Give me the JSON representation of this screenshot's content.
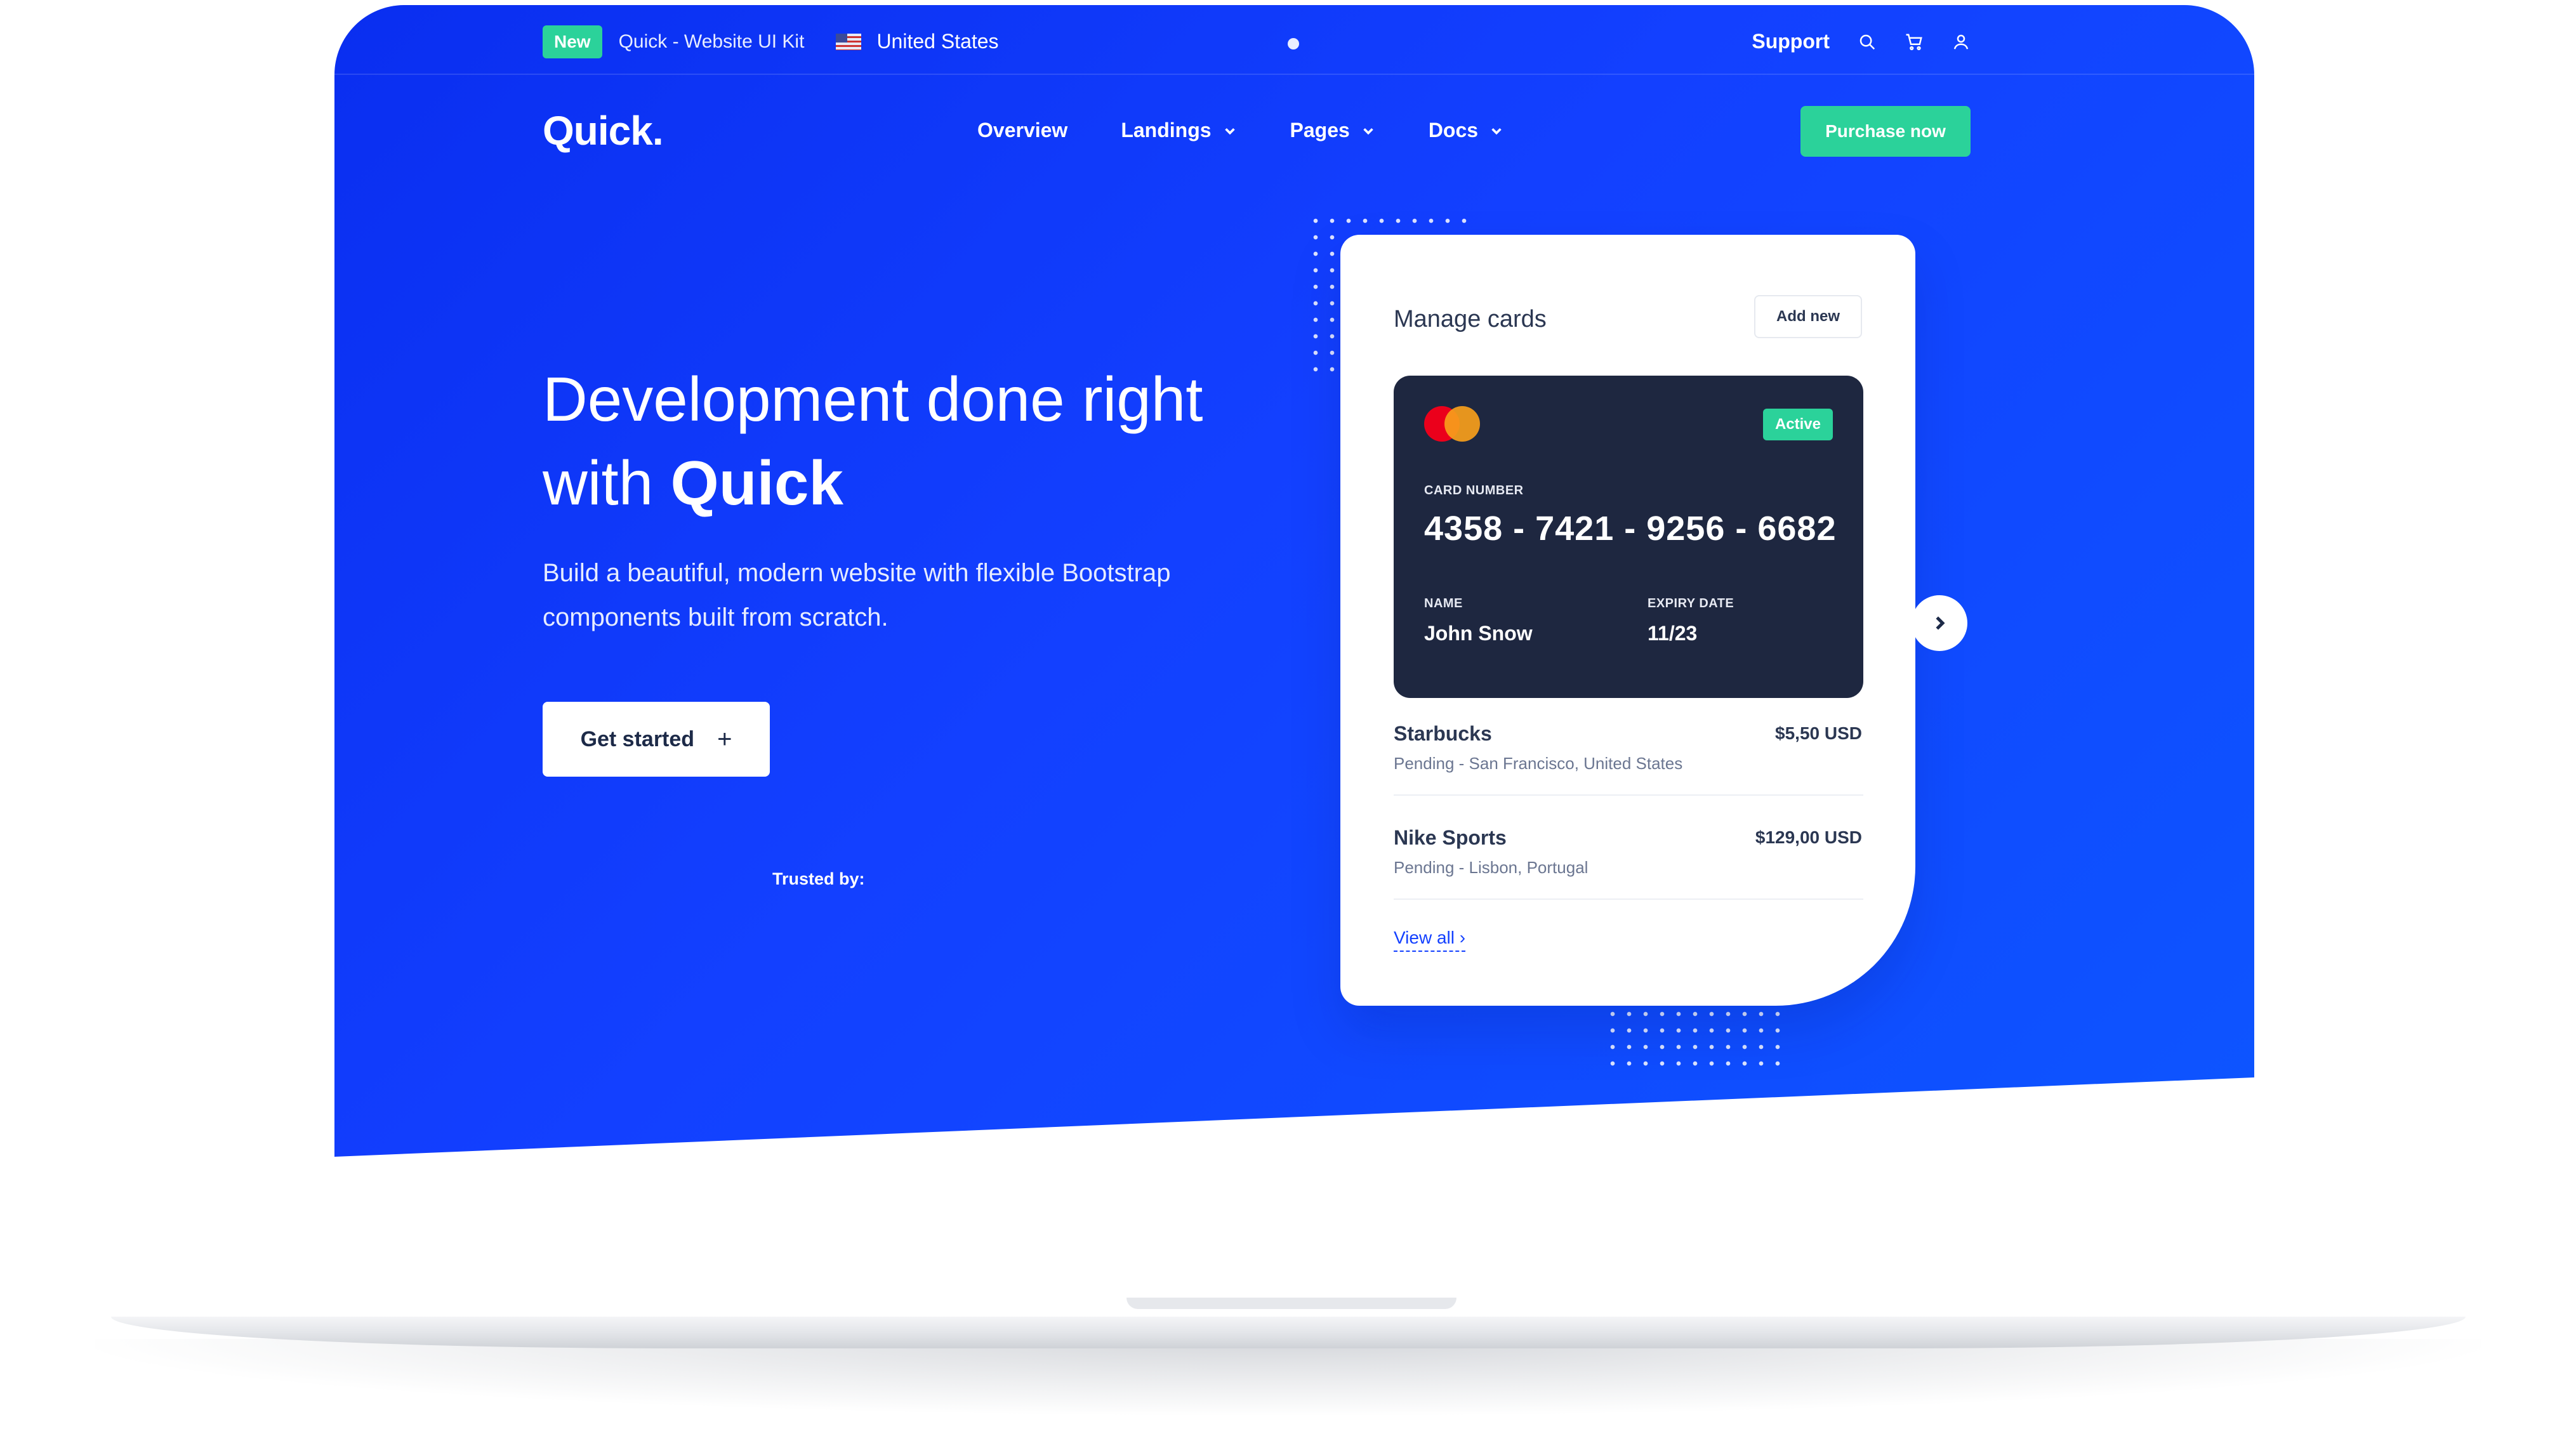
{
  "topbar": {
    "badge": "New",
    "kit_name": "Quick - Website UI Kit",
    "country": "United States",
    "support": "Support",
    "icons": [
      "search-icon",
      "cart-icon",
      "user-icon"
    ]
  },
  "nav": {
    "logo": "Quick.",
    "links": [
      {
        "label": "Overview",
        "dropdown": false
      },
      {
        "label": "Landings",
        "dropdown": true
      },
      {
        "label": "Pages",
        "dropdown": true
      },
      {
        "label": "Docs",
        "dropdown": true
      }
    ],
    "cta": "Purchase now"
  },
  "hero": {
    "title_line1": "Development done right",
    "title_with": "with",
    "title_brand": "Quick",
    "subtitle_line1": "Build a beautiful, modern website with flexible Bootstrap",
    "subtitle_line2": "components built from scratch.",
    "cta": "Get started",
    "cta_icon": "+",
    "trusted": "Trusted by:"
  },
  "card_panel": {
    "title": "Manage cards",
    "add_button": "Add new",
    "card": {
      "status": "Active",
      "number_label": "CARD NUMBER",
      "number": "4358 - 7421 - 9256 - 6682",
      "name_label": "NAME",
      "name": "John Snow",
      "expiry_label": "EXPIRY DATE",
      "expiry": "11/23"
    },
    "transactions": [
      {
        "merchant": "Starbucks",
        "amount": "$5,50 USD",
        "status": "Pending - San Francisco, United States"
      },
      {
        "merchant": "Nike Sports",
        "amount": "$129,00 USD",
        "status": "Pending - Lisbon, Portugal"
      }
    ],
    "view_all": "View all ›"
  },
  "colors": {
    "primary": "#1340ff",
    "accent_green": "#2bd29a",
    "card_dark": "#1e2740"
  }
}
